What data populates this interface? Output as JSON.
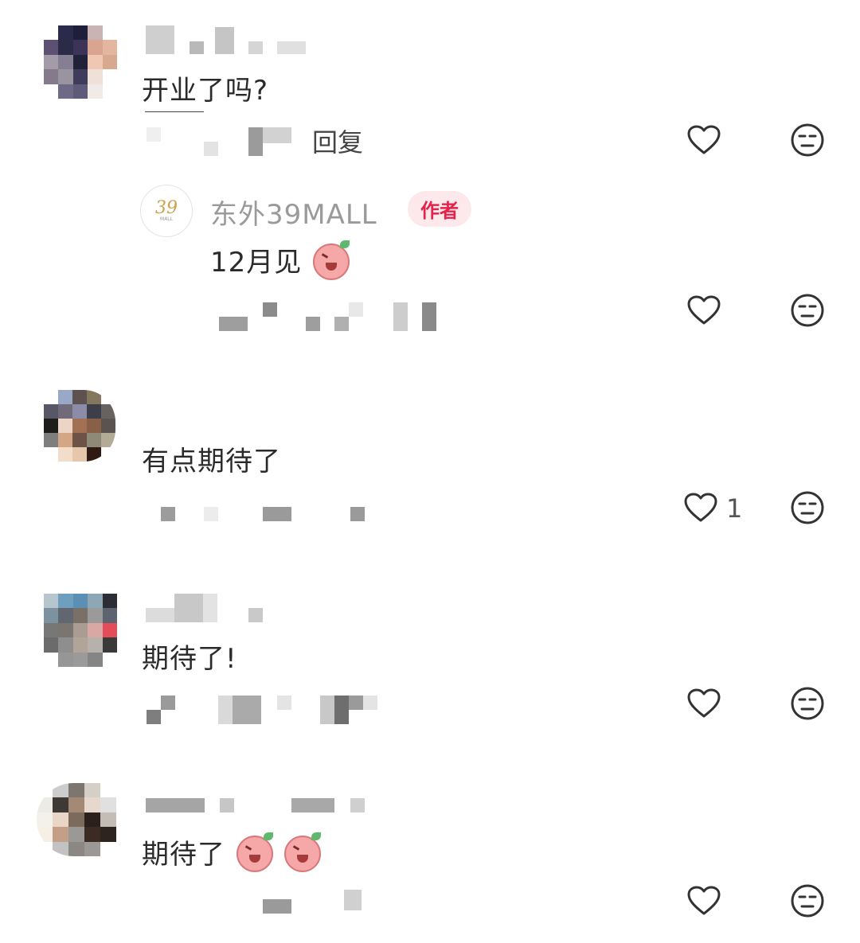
{
  "comments": [
    {
      "text": "开业了吗?",
      "reply_label": "回复",
      "icons": {
        "like": "heart-icon",
        "dislike": "meh-face-icon"
      },
      "replies": [
        {
          "author": "东外39MALL",
          "badge": "作者",
          "text": "12月见",
          "logo_text": "39",
          "logo_sub": "MALL",
          "emoji": "laughing-pig-emoji"
        }
      ]
    },
    {
      "text": "有点期待了",
      "like_count": "1"
    },
    {
      "text": "期待了!"
    },
    {
      "text": "期待了",
      "emojis": [
        "laughing-pig-emoji",
        "laughing-pig-emoji"
      ]
    }
  ],
  "colors": {
    "badge_bg": "#fde8ec",
    "badge_text": "#e4234b",
    "author_name": "#9a9a9a",
    "logo_gold": "#c9a449"
  }
}
